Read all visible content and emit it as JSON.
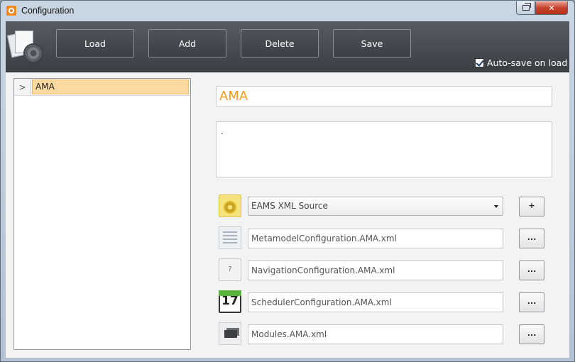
{
  "window": {
    "title": "Configuration"
  },
  "toolbar": {
    "load_label": "Load",
    "add_label": "Add",
    "delete_label": "Delete",
    "save_label": "Save",
    "autosave_label": "Auto-save on load",
    "autosave_checked": true
  },
  "tree": {
    "items": [
      {
        "label": "AMA",
        "selected": true,
        "expander": ">"
      }
    ]
  },
  "details": {
    "name": "AMA",
    "description": ".",
    "source": {
      "selected": "EAMS XML Source",
      "add_label": "+"
    },
    "files": [
      {
        "value": "MetamodelConfiguration.AMA.xml",
        "button_label": "...",
        "icon": "metamodel-icon"
      },
      {
        "value": "NavigationConfiguration.AMA.xml",
        "button_label": "...",
        "icon": "navigation-icon",
        "icon_glyph": "?"
      },
      {
        "value": "SchedulerConfiguration.AMA.xml",
        "button_label": "...",
        "icon": "calendar-icon",
        "icon_glyph": "17"
      },
      {
        "value": "Modules.AMA.xml",
        "button_label": "...",
        "icon": "modules-icon"
      }
    ]
  },
  "colors": {
    "accent": "#f39c1f",
    "selection": "#fcd9a1",
    "toolbar": "#3a3e43"
  }
}
